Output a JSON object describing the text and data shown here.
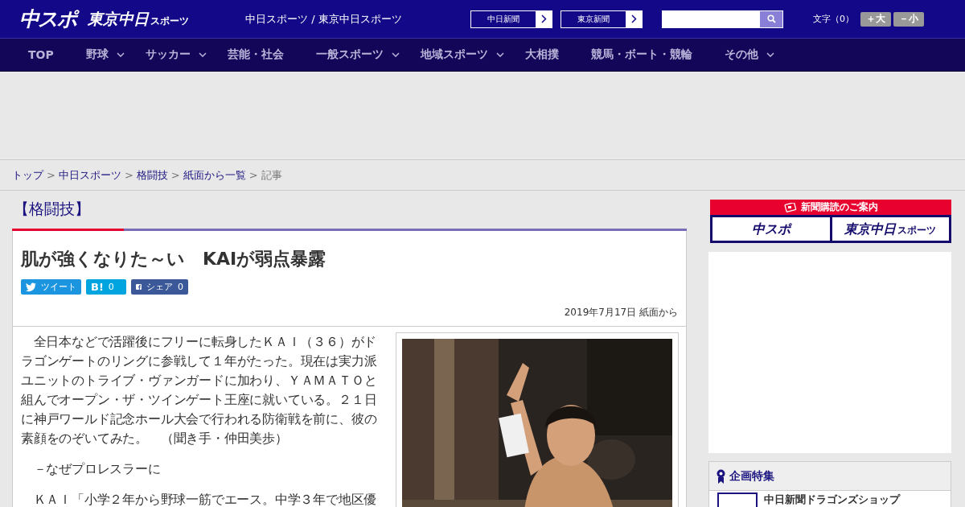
{
  "header": {
    "logo_main": "中スポ",
    "logo_sub": "東京中日",
    "logo_sub_small": "スポーツ",
    "tagline": "中日スポーツ / 東京中日スポーツ",
    "paper_links": [
      "中日新聞",
      "東京新聞"
    ],
    "font_size": {
      "label": "文字（0）",
      "buttons": [
        "＋大",
        "－小"
      ]
    }
  },
  "nav": [
    {
      "label": "TOP",
      "dropdown": false
    },
    {
      "label": "野球",
      "dropdown": true
    },
    {
      "label": "サッカー",
      "dropdown": true
    },
    {
      "label": "芸能・社会",
      "dropdown": false
    },
    {
      "label": "一般スポーツ",
      "dropdown": true
    },
    {
      "label": "地域スポーツ",
      "dropdown": true
    },
    {
      "label": "大相撲",
      "dropdown": false
    },
    {
      "label": "競馬・ボート・競輪",
      "dropdown": false
    },
    {
      "label": "その他",
      "dropdown": true
    }
  ],
  "breadcrumb": [
    {
      "label": "トップ",
      "link": true
    },
    {
      "label": "中日スポーツ",
      "link": true
    },
    {
      "label": "格闘技",
      "link": true
    },
    {
      "label": "紙面から一覧",
      "link": true
    },
    {
      "label": "記事",
      "link": false
    }
  ],
  "breadcrumb_separator": ">",
  "category": "【格闘技】",
  "article": {
    "title": "肌が強くなりた～い　KAIが弱点暴露",
    "share": [
      {
        "kind": "twitter",
        "label": "ツイート"
      },
      {
        "kind": "hatena",
        "label": "B!",
        "count": "0"
      },
      {
        "kind": "facebook",
        "label": "シェア",
        "count": "0"
      }
    ],
    "date": "2019年7月17日 紙面から",
    "paragraphs": [
      "全日本などで活躍後にフリーに転身したＫＡＩ（３６）がドラゴンゲートのリングに参戦して１年がたった。現在は実力派ユニットのトライブ・ヴァンガードに加わり、ＹＡＭＡＴＯと組んでオープン・ザ・ツインゲート王座に就いている。２１日に神戸ワールド記念ホール大会で行われる防衛戦を前に、彼の素顔をのぞいてみた。　（聞き手・仲田美歩）",
      "－なぜプロレスラーに",
      "ＫＡＩ「小学２年から野球一筋でエース。中学３年で地区優"
    ]
  },
  "sidebar": {
    "subscribe": {
      "title": "新聞購読のご案内",
      "logos": [
        "中スポ",
        "東京中日"
      ],
      "logo_small": "スポーツ"
    },
    "feature": {
      "title": "企画特集",
      "items": [
        "中日新聞ドラゴンズショップ"
      ]
    }
  }
}
